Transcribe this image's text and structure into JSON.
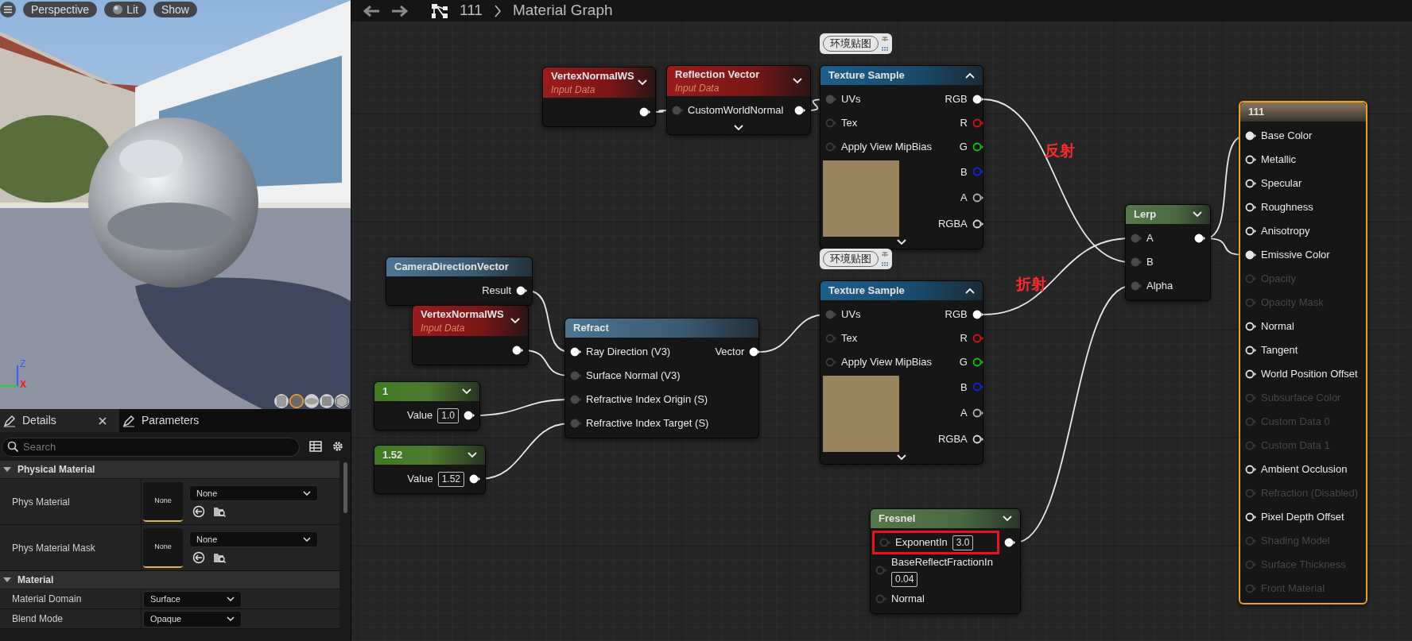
{
  "viewport": {
    "axes": [
      "Z",
      "X"
    ],
    "toolbar": [
      {
        "label": "Perspective",
        "kind": "text"
      },
      {
        "label": "Lit",
        "kind": "lit"
      },
      {
        "label": "Show",
        "kind": "text"
      }
    ]
  },
  "details": {
    "tabs": [
      {
        "label": "Details",
        "selected": true
      },
      {
        "label": "Parameters",
        "selected": false
      }
    ],
    "search": {
      "placeholder": "Search"
    },
    "sections": [
      {
        "title": "Physical Material",
        "expanded": true,
        "rows": [
          {
            "label": "Phys Material",
            "kind": "asset",
            "thumbnail": "None",
            "value": "None"
          },
          {
            "label": "Phys Material Mask",
            "kind": "asset",
            "thumbnail": "None",
            "value": "None"
          }
        ]
      },
      {
        "title": "Material",
        "expanded": true,
        "rows": [
          {
            "label": "Material Domain",
            "kind": "dropdown",
            "value": "Surface"
          },
          {
            "label": "Blend Mode",
            "kind": "dropdown",
            "value": "Opaque"
          }
        ]
      }
    ]
  },
  "graph": {
    "breadcrumb": [
      "111",
      "Material Graph"
    ],
    "nodes": [
      {
        "title": "VertexNormalWS",
        "subtitle": "Input Data",
        "kind": "input_data",
        "selected": false,
        "preview_expanded": false,
        "outputs": [
          {
            "connected": true,
            "color": "#ffffff"
          }
        ]
      },
      {
        "title": "Reflection Vector",
        "subtitle": "Input Data",
        "kind": "input_data",
        "selected": false,
        "preview_expanded": false,
        "advanced": true,
        "inputs": [
          {
            "label": "CustomWorldNormal",
            "connected": true,
            "color": "#4a4a4a"
          }
        ],
        "outputs": [
          {
            "connected": true,
            "color": "#ffffff"
          }
        ]
      },
      {
        "title": "Texture Sample",
        "kind": "texture",
        "comment": "环境贴图",
        "selected": false,
        "preview_expanded": true,
        "advanced": true,
        "has_preview": true,
        "inputs": [
          {
            "label": "UVs",
            "connected": true,
            "color": "#4a4a4a"
          },
          {
            "label": "Tex",
            "connected": false,
            "color": "#3c3c3c"
          },
          {
            "label": "Apply View MipBias",
            "connected": false,
            "color": "#3c3c3c"
          }
        ],
        "outputs": [
          {
            "label": "RGB",
            "connected": true,
            "color": "#ffffff"
          },
          {
            "label": "R",
            "connected": false,
            "color": "#e01010"
          },
          {
            "label": "G",
            "connected": false,
            "color": "#14c414"
          },
          {
            "label": "B",
            "connected": false,
            "color": "#1424e0"
          },
          {
            "label": "A",
            "connected": false,
            "color": "#b4b4b4"
          },
          {
            "label": "RGBA",
            "connected": false,
            "color": "#dcdcdc"
          }
        ]
      },
      {
        "title": "Texture Sample",
        "kind": "texture",
        "comment": "环境贴图",
        "selected": false,
        "preview_expanded": true,
        "advanced": true,
        "has_preview": true,
        "inputs": [
          {
            "label": "UVs",
            "connected": true,
            "color": "#4a4a4a"
          },
          {
            "label": "Tex",
            "connected": false,
            "color": "#3c3c3c"
          },
          {
            "label": "Apply View MipBias",
            "connected": false,
            "color": "#3c3c3c"
          }
        ],
        "outputs": [
          {
            "label": "RGB",
            "connected": true,
            "color": "#ffffff"
          },
          {
            "label": "R",
            "connected": false,
            "color": "#e01010"
          },
          {
            "label": "G",
            "connected": false,
            "color": "#14c414"
          },
          {
            "label": "B",
            "connected": false,
            "color": "#1424e0"
          },
          {
            "label": "A",
            "connected": false,
            "color": "#b4b4b4"
          },
          {
            "label": "RGBA",
            "connected": false,
            "color": "#dcdcdc"
          }
        ]
      },
      {
        "title": "CameraDirectionVector",
        "kind": "expression",
        "selected": false,
        "outputs": [
          {
            "label": "Result",
            "connected": true,
            "color": "#ffffff"
          }
        ]
      },
      {
        "title": "VertexNormalWS",
        "subtitle": "Input Data",
        "kind": "input_data",
        "selected": false,
        "preview_expanded": false,
        "outputs": [
          {
            "connected": true,
            "color": "#ffffff"
          }
        ]
      },
      {
        "title": "Refract",
        "kind": "expression",
        "selected": false,
        "inputs": [
          {
            "label": "Ray Direction (V3)",
            "connected": true,
            "color": "#ffffff"
          },
          {
            "label": "Surface Normal (V3)",
            "connected": true,
            "color": "#4a4a4a"
          },
          {
            "label": "Refractive Index Origin (S)",
            "connected": true,
            "color": "#4a4a4a"
          },
          {
            "label": "Refractive Index Target (S)",
            "connected": true,
            "color": "#4a4a4a"
          }
        ],
        "outputs": [
          {
            "label": "Vector",
            "connected": true,
            "color": "#ffffff"
          }
        ]
      },
      {
        "title": "1",
        "kind": "constant",
        "selected": false,
        "preview_expanded": false,
        "outputs": [
          {
            "label": "Value",
            "value": "1.0",
            "connected": true,
            "color": "#ffffff"
          }
        ]
      },
      {
        "title": "1.52",
        "kind": "constant",
        "selected": false,
        "preview_expanded": false,
        "outputs": [
          {
            "label": "Value",
            "value": "1.52",
            "connected": true,
            "color": "#ffffff"
          }
        ]
      },
      {
        "title": "Lerp",
        "kind": "math",
        "selected": false,
        "preview_expanded": false,
        "inputs": [
          {
            "label": "A",
            "connected": true,
            "color": "#4a4a4a"
          },
          {
            "label": "B",
            "connected": true,
            "color": "#4a4a4a"
          },
          {
            "label": "Alpha",
            "connected": true,
            "color": "#4a4a4a"
          }
        ],
        "outputs": [
          {
            "connected": true,
            "color": "#ffffff"
          }
        ]
      },
      {
        "title": "Fresnel",
        "kind": "math",
        "selected": false,
        "preview_expanded": false,
        "inputs": [
          {
            "label": "ExponentIn",
            "value": "3.0",
            "highlighted": true,
            "connected": false,
            "color": "#3c3c3c"
          },
          {
            "label": "BaseReflectFractionIn",
            "value": "0.04",
            "highlighted": false,
            "connected": false,
            "color": "#3c3c3c"
          },
          {
            "label": "Normal",
            "highlighted": false,
            "connected": false,
            "color": "#3c3c3c"
          }
        ],
        "outputs": [
          {
            "connected": true,
            "color": "#ffffff"
          }
        ]
      },
      {
        "title": "111",
        "kind": "result",
        "selected": true,
        "inputs": [
          {
            "label": "Base Color",
            "connected": true,
            "disabled": false,
            "color": "#e6e6e6"
          },
          {
            "label": "Metallic",
            "connected": false,
            "disabled": false,
            "color": "#e6e6e6"
          },
          {
            "label": "Specular",
            "connected": false,
            "disabled": false,
            "color": "#e6e6e6"
          },
          {
            "label": "Roughness",
            "connected": false,
            "disabled": false,
            "color": "#e6e6e6"
          },
          {
            "label": "Anisotropy",
            "connected": false,
            "disabled": false,
            "color": "#e6e6e6"
          },
          {
            "label": "Emissive Color",
            "connected": true,
            "disabled": false,
            "color": "#e6e6e6"
          },
          {
            "label": "Opacity",
            "connected": false,
            "disabled": true,
            "color": "#383838"
          },
          {
            "label": "Opacity Mask",
            "connected": false,
            "disabled": true,
            "color": "#383838"
          },
          {
            "label": "Normal",
            "connected": false,
            "disabled": false,
            "color": "#e6e6e6"
          },
          {
            "label": "Tangent",
            "connected": false,
            "disabled": false,
            "color": "#e6e6e6"
          },
          {
            "label": "World Position Offset",
            "connected": false,
            "disabled": false,
            "color": "#e6e6e6"
          },
          {
            "label": "Subsurface Color",
            "connected": false,
            "disabled": true,
            "color": "#383838"
          },
          {
            "label": "Custom Data 0",
            "connected": false,
            "disabled": true,
            "color": "#383838"
          },
          {
            "label": "Custom Data 1",
            "connected": false,
            "disabled": true,
            "color": "#383838"
          },
          {
            "label": "Ambient Occlusion",
            "connected": false,
            "disabled": false,
            "color": "#e6e6e6"
          },
          {
            "label": "Refraction (Disabled)",
            "connected": false,
            "disabled": true,
            "color": "#383838"
          },
          {
            "label": "Pixel Depth Offset",
            "connected": false,
            "disabled": false,
            "color": "#e6e6e6"
          },
          {
            "label": "Shading Model",
            "connected": false,
            "disabled": true,
            "color": "#383838"
          },
          {
            "label": "Surface Thickness",
            "connected": false,
            "disabled": true,
            "color": "#383838"
          },
          {
            "label": "Front Material",
            "connected": false,
            "disabled": true,
            "color": "#383838"
          }
        ]
      }
    ],
    "annotations": [
      "反射",
      "折射"
    ]
  }
}
